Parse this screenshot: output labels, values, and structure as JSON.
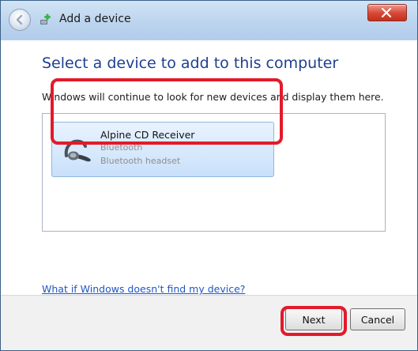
{
  "window": {
    "title": "Add a device"
  },
  "main": {
    "heading": "Select a device to add to this computer",
    "description": "Windows will continue to look for new devices and display them here.",
    "devices": [
      {
        "name": "Alpine CD Receiver",
        "type": "Bluetooth",
        "subtype": "Bluetooth headset",
        "icon": "bluetooth-headset-icon"
      }
    ],
    "help_link": "What if Windows doesn't find my device?"
  },
  "footer": {
    "next_label": "Next",
    "cancel_label": "Cancel"
  },
  "colors": {
    "highlight": "#e31a2a",
    "link": "#1f56c6",
    "heading": "#1f3f8f",
    "selection": "#d7e9fc"
  }
}
